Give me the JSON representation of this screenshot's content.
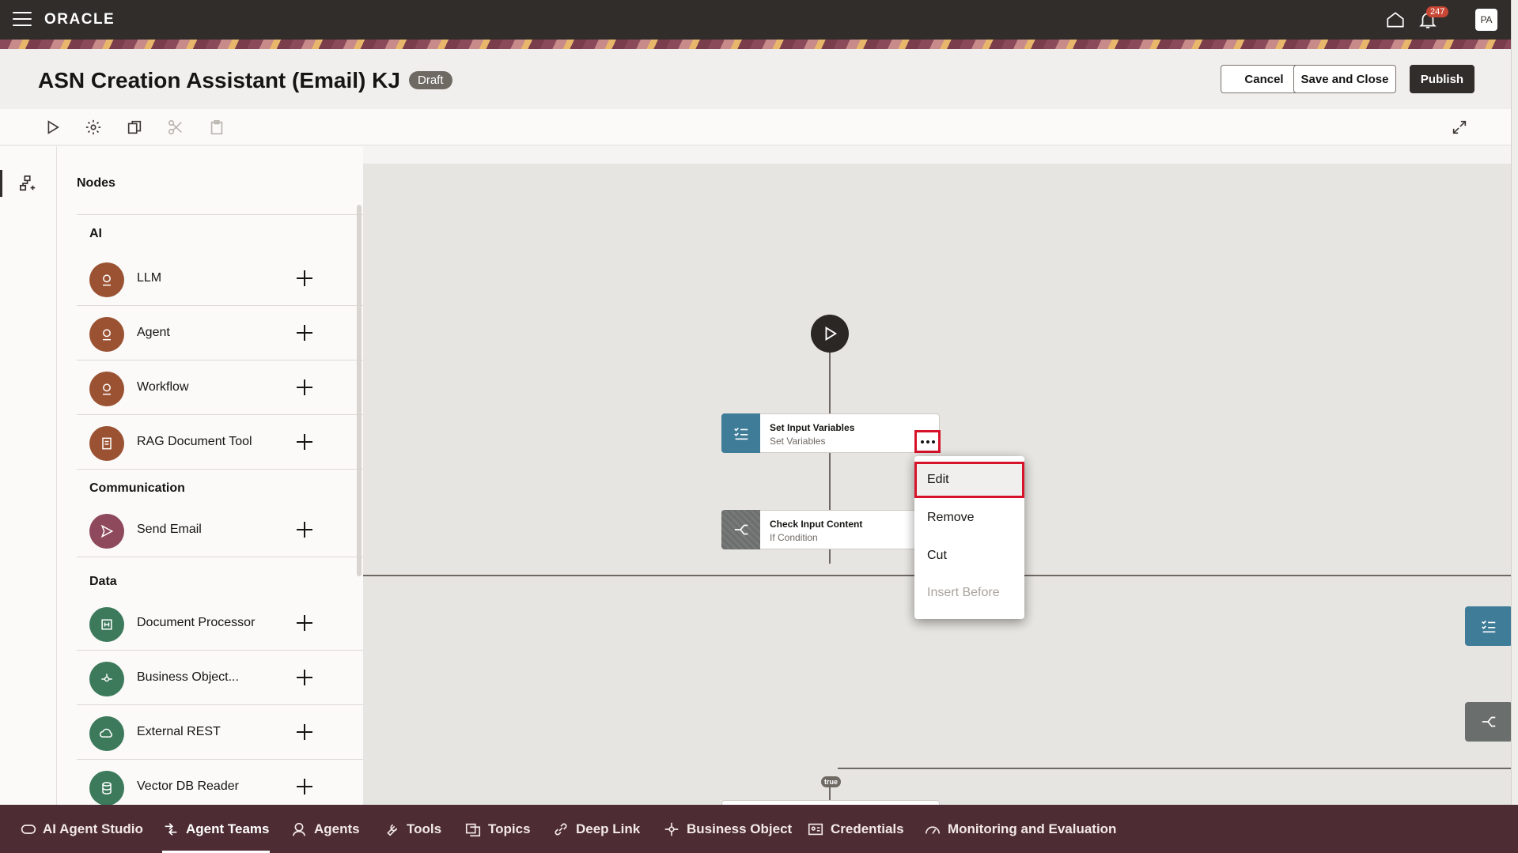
{
  "topbar": {
    "brand": "ORACLE",
    "notification_count": "247",
    "avatar_initials": "PA"
  },
  "header": {
    "title": "ASN Creation Assistant (Email) KJ",
    "status_badge": "Draft",
    "cancel_label": "Cancel",
    "save_close_label": "Save and Close",
    "publish_label": "Publish"
  },
  "panel": {
    "title": "Nodes",
    "sections": {
      "ai": {
        "label": "AI",
        "items": [
          "LLM",
          "Agent",
          "Workflow",
          "RAG Document Tool"
        ]
      },
      "communication": {
        "label": "Communication",
        "items": [
          "Send Email"
        ]
      },
      "data": {
        "label": "Data",
        "items": [
          "Document Processor",
          "Business Object...",
          "External REST",
          "Vector DB Reader"
        ]
      }
    }
  },
  "canvas": {
    "nodes": [
      {
        "name": "Set Input Variables",
        "type": "Set Variables"
      },
      {
        "name": "Check Input Content",
        "type": "If Condition"
      }
    ],
    "branch_label": "true",
    "context_menu": [
      "Edit",
      "Remove",
      "Cut",
      "Insert Before"
    ]
  },
  "bottom_nav": [
    "AI Agent Studio",
    "Agent Teams",
    "Agents",
    "Tools",
    "Topics",
    "Deep Link",
    "Business Object",
    "Credentials",
    "Monitoring and Evaluation"
  ],
  "colors": {
    "topbar": "#312d2a",
    "bottom_nav": "#4d2c33",
    "highlight": "#d7132a",
    "node_blue": "#3f7c98"
  }
}
